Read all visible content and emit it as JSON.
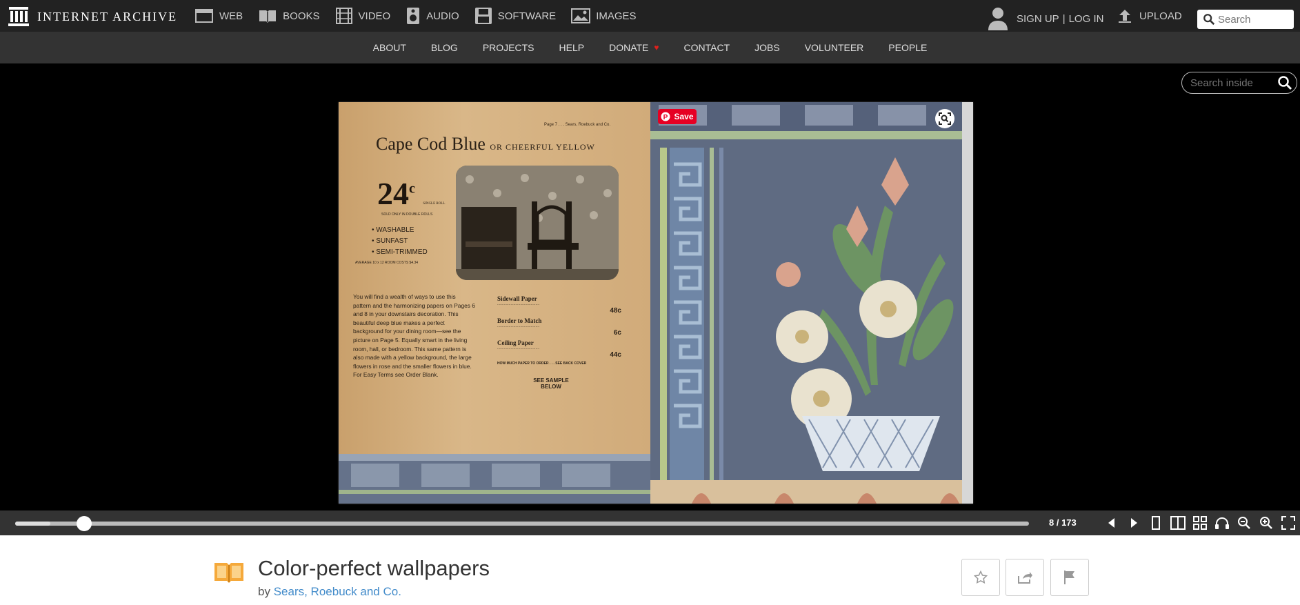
{
  "header": {
    "logo_text": "INTERNET ARCHIVE",
    "media_types": [
      {
        "label": "WEB",
        "icon": "web-icon"
      },
      {
        "label": "BOOKS",
        "icon": "books-icon"
      },
      {
        "label": "VIDEO",
        "icon": "video-icon"
      },
      {
        "label": "AUDIO",
        "icon": "audio-icon"
      },
      {
        "label": "SOFTWARE",
        "icon": "software-icon"
      },
      {
        "label": "IMAGES",
        "icon": "images-icon"
      }
    ],
    "signup": "SIGN UP",
    "separator": "|",
    "login": "LOG IN",
    "upload": "UPLOAD",
    "search_placeholder": "Search"
  },
  "subnav": {
    "items": [
      "ABOUT",
      "BLOG",
      "PROJECTS",
      "HELP",
      "DONATE",
      "CONTACT",
      "JOBS",
      "VOLUNTEER",
      "PEOPLE"
    ]
  },
  "viewer": {
    "search_inside_placeholder": "Search inside",
    "pin_save_label": "Save",
    "page_indicator": "8 / 173",
    "progress_fraction": 0.035,
    "left_page": {
      "header": "Page 7 . . . Sears, Roebuck and Co.",
      "title_main": "Cape Cod Blue",
      "title_rest": "OR CHEERFUL YELLOW",
      "price": "24",
      "price_unit": "c",
      "price_note": "SINGLE ROLL",
      "sold_note": "SOLD ONLY IN DOUBLE ROLLS",
      "features": [
        "WASHABLE",
        "SUNFAST",
        "SEMI-TRIMMED"
      ],
      "average": "AVERAGE 10 x 12 ROOM COSTS $4.34",
      "body": "You will find a wealth of ways to use this pattern and the harmonizing papers on Pages 6 and 8 in your downstairs decoration. This beautiful deep blue makes a perfect background for your dining room—see the picture on Page 5. Equally smart in the living room, hall, or bedroom. This same pattern is also made with a yellow background, the large flowers in rose and the smaller flowers in blue. For Easy Terms see Order Blank.",
      "sections": [
        {
          "heading": "Sidewall Paper",
          "price": "48c"
        },
        {
          "heading": "Border to Match",
          "price": "6c"
        },
        {
          "heading": "Ceiling Paper",
          "price": "44c"
        }
      ],
      "order_note": "HOW MUCH PAPER TO ORDER . . . SEE BACK COVER",
      "sample_note": "SEE SAMPLE BELOW"
    }
  },
  "item": {
    "title": "Color-perfect wallpapers",
    "by_prefix": "by",
    "author": "Sears, Roebuck and Co."
  },
  "colors": {
    "topbar": "#222222",
    "subnav": "#333333",
    "link": "#428bca",
    "pinterest": "#e60023",
    "donate_heart": "#e0201c"
  }
}
